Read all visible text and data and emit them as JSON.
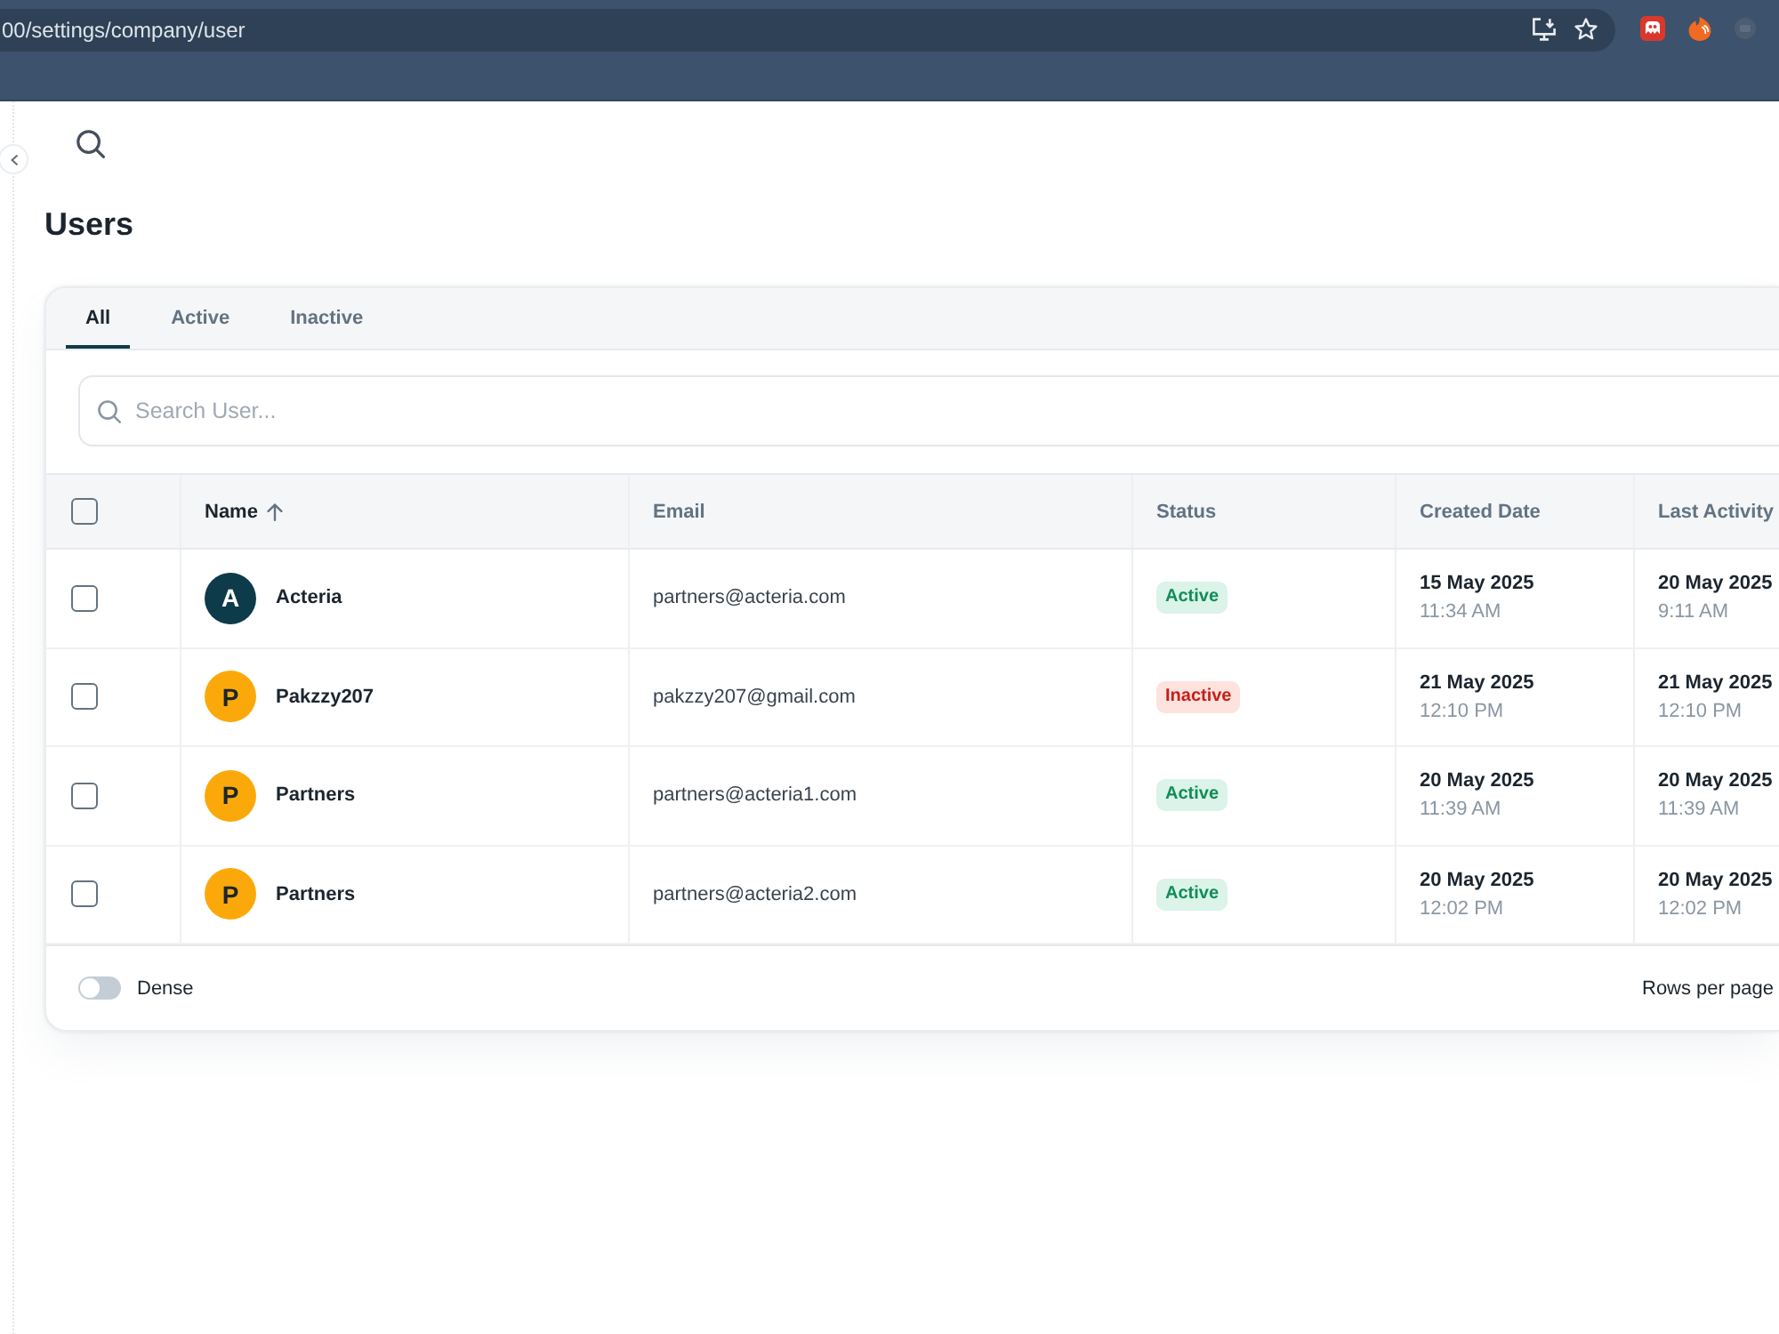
{
  "browser": {
    "address": "00/settings/company/user"
  },
  "page": {
    "title": "Users"
  },
  "tabs": [
    {
      "label": "All",
      "selected": true
    },
    {
      "label": "Active",
      "selected": false
    },
    {
      "label": "Inactive",
      "selected": false
    }
  ],
  "search": {
    "placeholder": "Search User..."
  },
  "table": {
    "select_all": {
      "checked": false
    },
    "columns": [
      {
        "label": "Name",
        "sorted": true
      },
      {
        "label": "Email",
        "sorted": false
      },
      {
        "label": "Status",
        "sorted": false
      },
      {
        "label": "Created Date",
        "sorted": false
      },
      {
        "label": "Last Activity",
        "sorted": false
      }
    ],
    "rows": [
      {
        "checked": false,
        "initial": "A",
        "color": "#0e3b4a",
        "name": "Acteria",
        "email": "partners@acteria.com",
        "status": {
          "label": "Active",
          "kind": "success"
        },
        "created": {
          "date": "15 May 2025",
          "time": "11:34 AM"
        },
        "last_activity": {
          "date": "20 May 2025",
          "time": "9:11 AM"
        }
      },
      {
        "checked": false,
        "initial": "P",
        "color": "#fba90a",
        "name": "Pakzzy207",
        "email": "pakzzy207@gmail.com",
        "status": {
          "label": "Inactive",
          "kind": "error"
        },
        "created": {
          "date": "21 May 2025",
          "time": "12:10 PM"
        },
        "last_activity": {
          "date": "21 May 2025",
          "time": "12:10 PM"
        }
      },
      {
        "checked": false,
        "initial": "P",
        "color": "#fba90a",
        "name": "Partners",
        "email": "partners@acteria1.com",
        "status": {
          "label": "Active",
          "kind": "success"
        },
        "created": {
          "date": "20 May 2025",
          "time": "11:39 AM"
        },
        "last_activity": {
          "date": "20 May 2025",
          "time": "11:39 AM"
        }
      },
      {
        "checked": false,
        "initial": "P",
        "color": "#fba90a",
        "name": "Partners",
        "email": "partners@acteria2.com",
        "status": {
          "label": "Active",
          "kind": "success"
        },
        "created": {
          "date": "20 May 2025",
          "time": "12:02 PM"
        },
        "last_activity": {
          "date": "20 May 2025",
          "time": "12:02 PM"
        }
      }
    ]
  },
  "footer": {
    "dense": {
      "label": "Dense",
      "on": false
    },
    "rows_per_page": "Rows per page"
  }
}
